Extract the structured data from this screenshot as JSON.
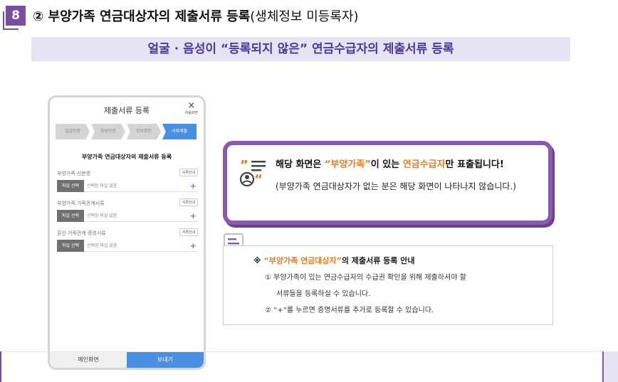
{
  "header": {
    "step_number": "8",
    "title_bold": "② 부양가족 연금대상자의 제출서류 등록",
    "title_rest": "(생체정보 미등록자)",
    "subtitle": "얼굴 · 음성이 “등록되지 않은” 연금수급자의 제출서류 등록"
  },
  "phone": {
    "title": "제출서류 등록",
    "close_label": "처음화면",
    "steps": [
      "얼굴인증",
      "음성인증",
      "정보확인",
      "서류제출"
    ],
    "heading": "부양가족 연금대상자의 제출서류 등록",
    "guide_label": "서류안내",
    "file_button_label": "파일 선택",
    "no_file_text": "선택된 파일 없음",
    "plus": "+",
    "fields": [
      {
        "label": "부양가족 신분증"
      },
      {
        "label": "부양가족 가족관계서류"
      },
      {
        "label": "혼인·가족관계 증명서류"
      }
    ],
    "home_button": "메인화면",
    "send_button": "보내기"
  },
  "callout": {
    "line1_pre": "해당 화면은 ",
    "line1_hl1": "“부양가족”",
    "line1_mid": "이 있는 ",
    "line1_hl2": "연금수급자",
    "line1_post": "만 표출됩니다!",
    "line2": "(부양가족 연금대상자가 없는 분은 해당 화면이 나타나지 않습니다.)"
  },
  "notice": {
    "mark": "※ ",
    "title_hl": "“부양가족 연금대상자”",
    "title_rest": "의 제출서류 등록 안내",
    "item1_line1": "① 부양가족이 있는 연금수급자의 수급권 확인을 위해 제출하셔야 할",
    "item1_line2": "서류들을 등록하실 수 있습니다.",
    "item2": "② “+”를 누르면 증명서류를 추가로 등록할 수 있습니다."
  },
  "colors": {
    "accent_purple": "#7a4fa0",
    "highlight_orange": "#f07a1e",
    "button_blue": "#4a90e2",
    "subtitle_bg": "#e6e4f2"
  }
}
